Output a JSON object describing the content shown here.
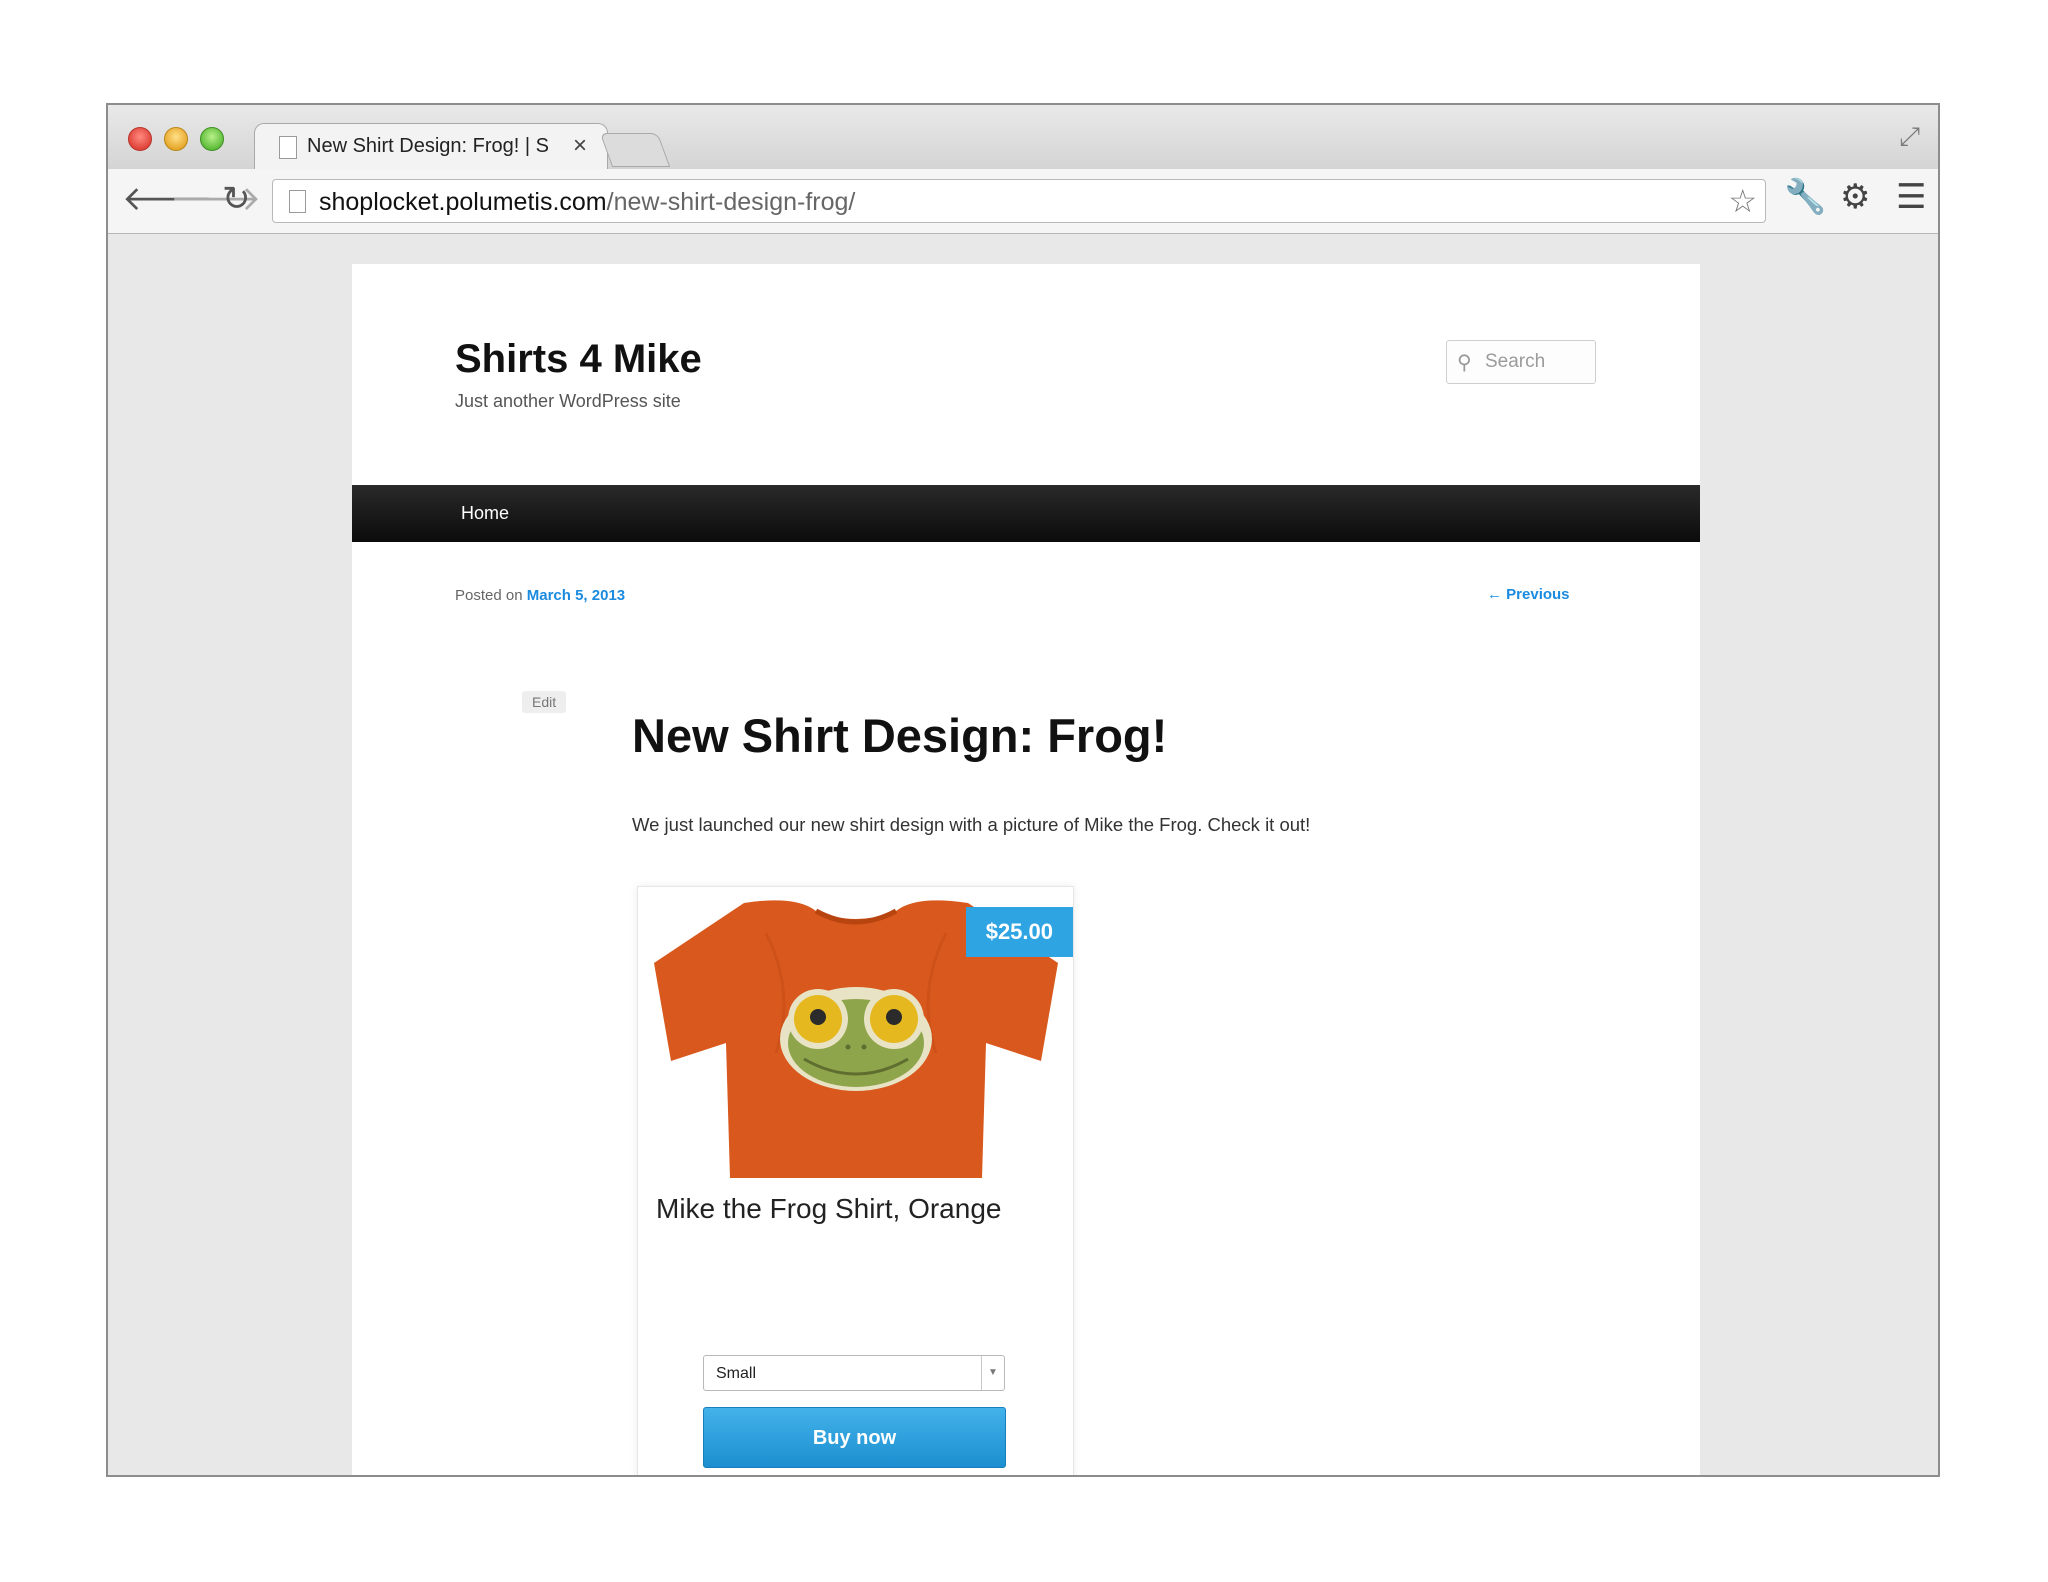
{
  "browser": {
    "tab_title": "New Shirt Design: Frog! | S",
    "tab_close": "×",
    "url_host": "shoplocket.polumetis.com",
    "url_path": "/new-shirt-design-frog/"
  },
  "site": {
    "title": "Shirts 4 Mike",
    "tagline": "Just another WordPress site",
    "search_placeholder": "Search"
  },
  "nav": {
    "home": "Home"
  },
  "post": {
    "posted_prefix": "Posted on",
    "date": "March 5, 2013",
    "previous": "← Previous",
    "edit": "Edit",
    "title": "New Shirt Design: Frog!",
    "body": "We just launched our new shirt design with a picture of Mike the Frog. Check it out!"
  },
  "product": {
    "price": "$25.00",
    "name": "Mike the Frog Shirt, Orange",
    "size_selected": "Small",
    "buy_label": "Buy now"
  },
  "colors": {
    "link": "#1b8be0",
    "price_badge": "#2fa4e2",
    "shirt": "#d9581d",
    "menubar": "#111111"
  }
}
